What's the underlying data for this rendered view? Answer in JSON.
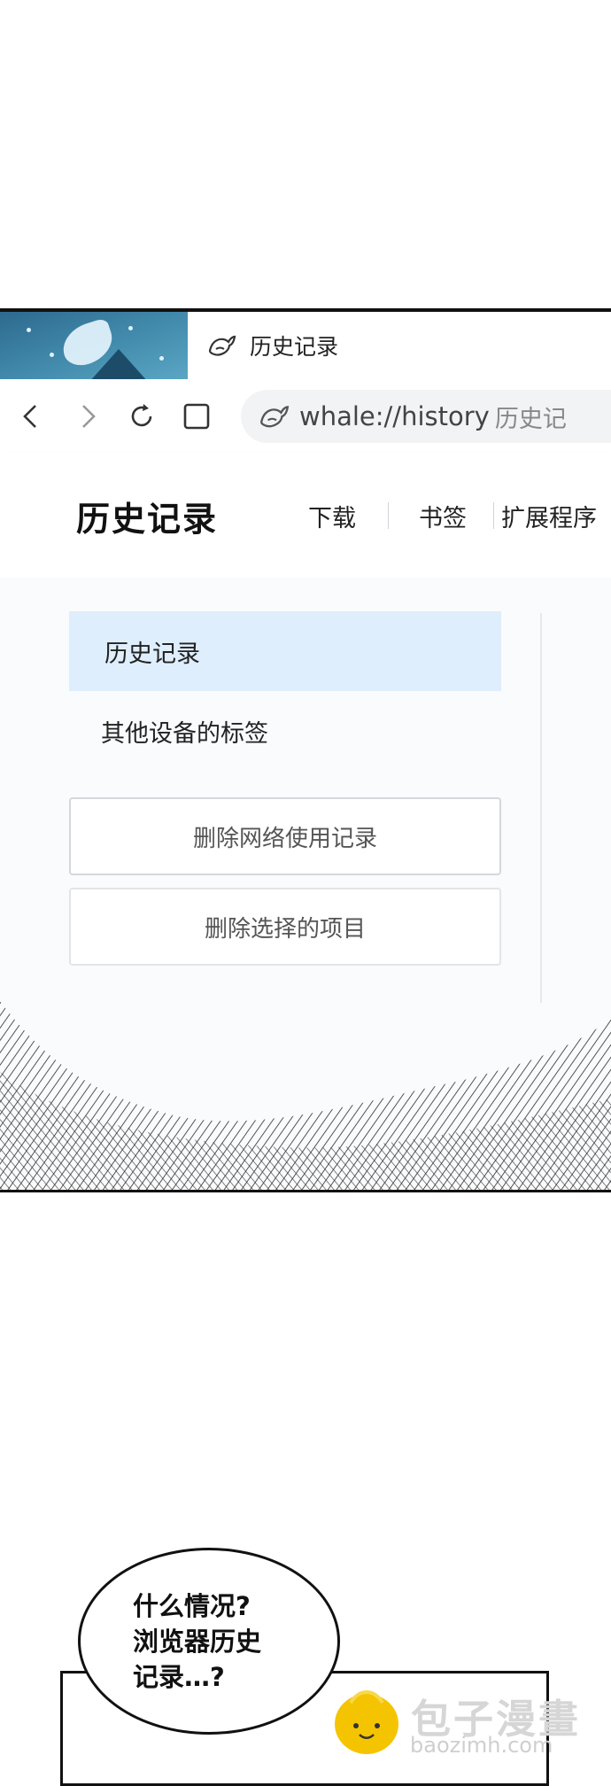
{
  "browser": {
    "tab": {
      "title": "历史记录",
      "favicon": "whale-icon"
    },
    "toolbar": {
      "back": "back-arrow-icon",
      "forward": "forward-arrow-icon",
      "reload": "reload-icon",
      "home": "square-icon"
    },
    "address_bar": {
      "url": "whale://history",
      "page_title": "历史记"
    },
    "header": {
      "title": "历史记录",
      "links": [
        "下载",
        "书签",
        "扩展程序"
      ]
    },
    "sidebar": {
      "items": [
        {
          "label": "历史记录",
          "active": true
        },
        {
          "label": "其他设备的标签",
          "active": false
        }
      ],
      "actions": [
        "删除网络使用记录",
        "删除选择的项目"
      ]
    },
    "colors": {
      "active_item_bg": "#dfeefc",
      "tab_art": "#3f86a8"
    }
  },
  "comic": {
    "speech_bubble": "什么情况?\n浏览器历史\n记录…?"
  },
  "watermark": {
    "brand": "包子漫畫",
    "domain": "baozimh.com"
  }
}
